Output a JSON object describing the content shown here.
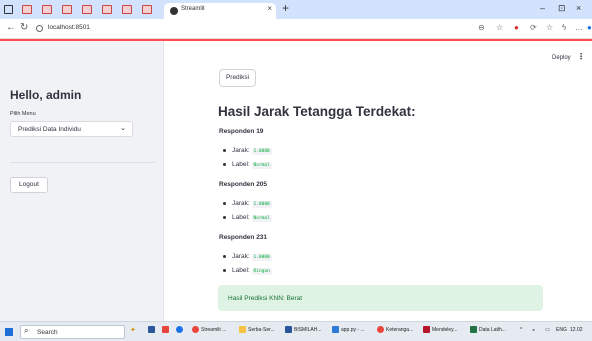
{
  "browser": {
    "tab_title": "Streamlit",
    "tab_close": "×",
    "new_tab": "+",
    "window_controls": [
      "–",
      "⊡",
      "×"
    ],
    "url": "localhost:8501"
  },
  "app": {
    "deploy_label": "Deploy",
    "menu_label": "⋮"
  },
  "sidebar": {
    "greeting": "Hello, admin",
    "menu_label": "Pilih Menu",
    "menu_value": "Prediksi Data Individu",
    "logout_label": "Logout"
  },
  "main": {
    "predict_button": "Prediksi",
    "heading": "Hasil Jarak Tetangga Terdekat:",
    "bullet_keys": {
      "distance": "Jarak:",
      "label": "Label:"
    },
    "neighbors": [
      {
        "title": "Responden 19",
        "distance": "1.0000",
        "label": "Normal"
      },
      {
        "title": "Responden 205",
        "distance": "1.0000",
        "label": "Normal"
      },
      {
        "title": "Responden 231",
        "distance": "1.0000",
        "label": "Ringan"
      }
    ],
    "result": "Hasil Prediksi KNN: Berat"
  },
  "taskbar": {
    "search_label": "Search",
    "apps": [
      {
        "label": "Streamlit ...",
        "color": "#e8453c"
      },
      {
        "label": "Serba-Ser...",
        "color": "#f5c242"
      },
      {
        "label": "BISMILAH...",
        "color": "#2b579a"
      },
      {
        "label": "app.py - ...",
        "color": "#2d7bd6"
      },
      {
        "label": "Keteranga...",
        "color": "#e8453c"
      },
      {
        "label": "Mendeley...",
        "color": "#b5162c"
      },
      {
        "label": "Data Latih...",
        "color": "#217346"
      }
    ],
    "language": "ENG",
    "time": "12.02"
  },
  "colors": {
    "accent_red": "#ff4b4b",
    "sidebar_bg": "#f0f2f6",
    "success_bg": "#dff3e5",
    "success_text": "#177233",
    "code_text": "#09ab3b"
  }
}
